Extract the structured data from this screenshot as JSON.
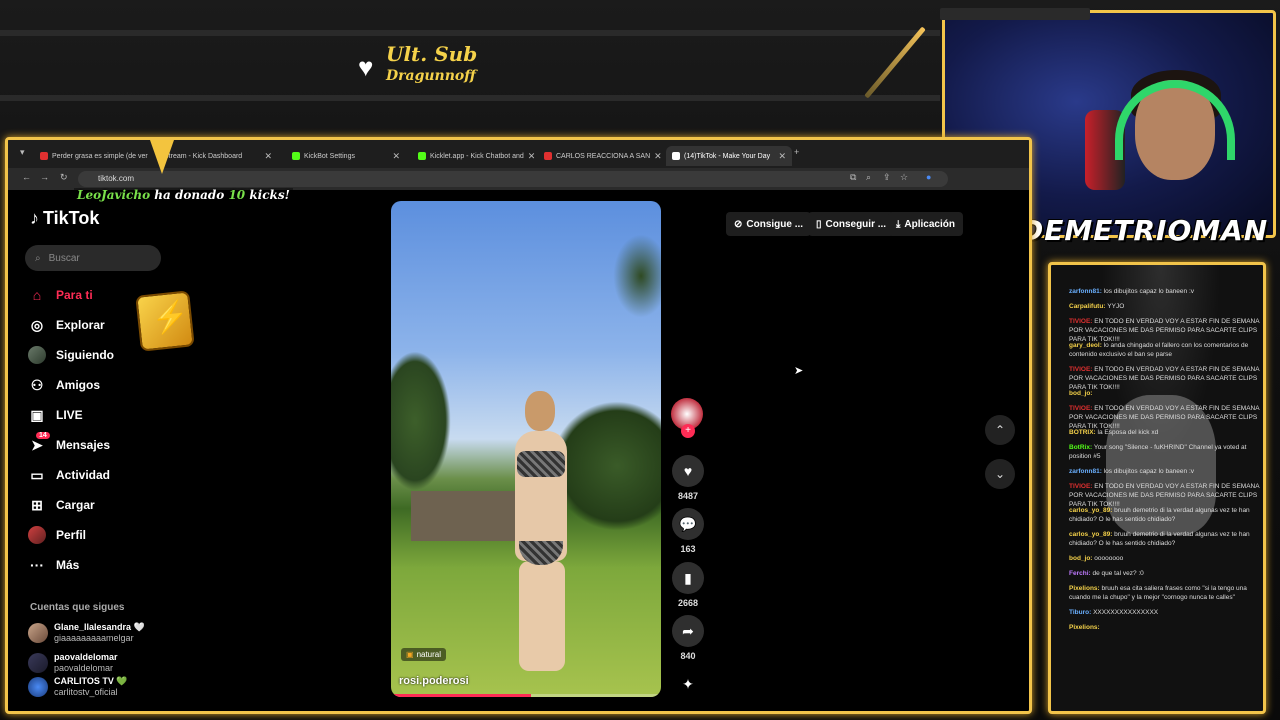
{
  "overlay": {
    "sub_label": "Ult. Sub",
    "sub_name": "Dragunnoff",
    "donation_user": "LeoJavicho",
    "donation_mid": " ha donado ",
    "donation_amount": "10",
    "donation_end": " kicks!",
    "streamer_name": "DEMETRIOMAN"
  },
  "browser": {
    "tabs": [
      {
        "label": "Perder grasa es simple (de ver",
        "color": "#e03030"
      },
      {
        "label": "Stream - Kick Dashboard",
        "color": "#53fc18"
      },
      {
        "label": "KickBot Settings",
        "color": "#53fc18"
      },
      {
        "label": "Kicklet.app - Kick Chatbot and",
        "color": "#53fc18"
      },
      {
        "label": "CARLOS REACCIONA A SAN",
        "color": "#e03030"
      },
      {
        "label": "(14)TikTok - Make Your Day",
        "color": "#ffffff"
      }
    ],
    "url": "tiktok.com"
  },
  "tiktok": {
    "logo": "TikTok",
    "search_placeholder": "Buscar",
    "nav": [
      {
        "label": "Para ti",
        "icon": "home-icon"
      },
      {
        "label": "Explorar",
        "icon": "compass-icon"
      },
      {
        "label": "Siguiendo",
        "icon": "following-icon"
      },
      {
        "label": "Amigos",
        "icon": "friends-icon"
      },
      {
        "label": "LIVE",
        "icon": "live-icon"
      },
      {
        "label": "Mensajes",
        "icon": "messages-icon"
      },
      {
        "label": "Actividad",
        "icon": "activity-icon"
      },
      {
        "label": "Cargar",
        "icon": "upload-icon"
      },
      {
        "label": "Perfil",
        "icon": "profile-icon"
      },
      {
        "label": "Más",
        "icon": "more-icon"
      }
    ],
    "messages_badge": "14",
    "following_title": "Cuentas que sigues",
    "following": [
      {
        "name": "Glane_llalesandra 🤍",
        "user": "giaaaaaaaaamelgar"
      },
      {
        "name": "paovaldelomar",
        "user": "paovaldelomar"
      },
      {
        "name": "CARLITOS TV 💚",
        "user": "carlitostv_oficial"
      }
    ],
    "top_buttons": [
      "Consigue ...",
      "Conseguir ...",
      "Aplicación"
    ],
    "video": {
      "tag": "natural",
      "username": "rosi.poderosi",
      "progress": 0.52
    },
    "actions": {
      "likes": "8487",
      "comments": "163",
      "saves": "2668",
      "shares": "840"
    }
  },
  "chat": [
    {
      "user": "zarfonn81",
      "msg": "los dibujitos capaz lo baneen :v",
      "color": "#6ab0ff"
    },
    {
      "user": "Carpalifutu",
      "msg": "YYJO",
      "color": "#f5d24a"
    },
    {
      "user": "TIVIOE",
      "msg": "EN TODO EN VERDAD VOY A ESTAR FIN DE SEMANA POR VACACIONES ME DAS PERMISO PARA SACARTE CLIPS PARA TIK TOK!!!!",
      "color": "#e03030"
    },
    {
      "user": "gary_deol",
      "msg": "lo anda chingado el fallero con los comentarios de contenido exclusivo el ban se parse",
      "color": "#f5d24a"
    },
    {
      "user": "TIVIOE",
      "msg": "EN TODO EN VERDAD VOY A ESTAR FIN DE SEMANA POR VACACIONES ME DAS PERMISO PARA SACARTE CLIPS PARA TIK TOK!!!!",
      "color": "#e03030"
    },
    {
      "user": "bod_jo",
      "msg": "",
      "color": "#f5d24a"
    },
    {
      "user": "TIVIOE",
      "msg": "EN TODO EN VERDAD VOY A ESTAR FIN DE SEMANA POR VACACIONES ME DAS PERMISO PARA SACARTE CLIPS PARA TIK TOK!!!!",
      "color": "#e03030"
    },
    {
      "user": "BOTRIX",
      "msg": "la Esposa del kick xd",
      "color": "#f5d24a"
    },
    {
      "user": "BotRix",
      "msg": "Your song \"Silence - fuKHRIND\" Channel ya voted at position #5",
      "color": "#53fc18"
    },
    {
      "user": "zarfonn81",
      "msg": "los dibujitos capaz lo baneen :v",
      "color": "#6ab0ff"
    },
    {
      "user": "TIVIOE",
      "msg": "EN TODO EN VERDAD VOY A ESTAR FIN DE SEMANA POR VACACIONES ME DAS PERMISO PARA SACARTE CLIPS PARA TIK TOK!!!!",
      "color": "#e03030"
    },
    {
      "user": "carlos_yo_89",
      "msg": "bruuh demetrio di la verdad algunas vez te han chidiado? O le has sentido chidiado?",
      "color": "#f5d24a"
    },
    {
      "user": "carlos_yo_89",
      "msg": "bruuh demetrio di la verdad algunas vez te han chidiado? O le has sentido chidiado?",
      "color": "#f5d24a"
    },
    {
      "user": "bod_jo",
      "msg": "oooooooo",
      "color": "#f5d24a"
    },
    {
      "user": "Ferchi",
      "msg": "de que tal vez? :0",
      "color": "#c07aff"
    },
    {
      "user": "Pixelions",
      "msg": "bruuh esa cita saliera frases como \"si la tengo una cuando me la chupo\" y la mejor \"cornogo nunca te calles\"",
      "color": "#f5d24a"
    },
    {
      "user": "Tiburo",
      "msg": "XXXXXXXXXXXXXXX",
      "color": "#6ab0ff"
    },
    {
      "user": "Pixelions",
      "msg": "",
      "color": "#f5d24a"
    }
  ]
}
